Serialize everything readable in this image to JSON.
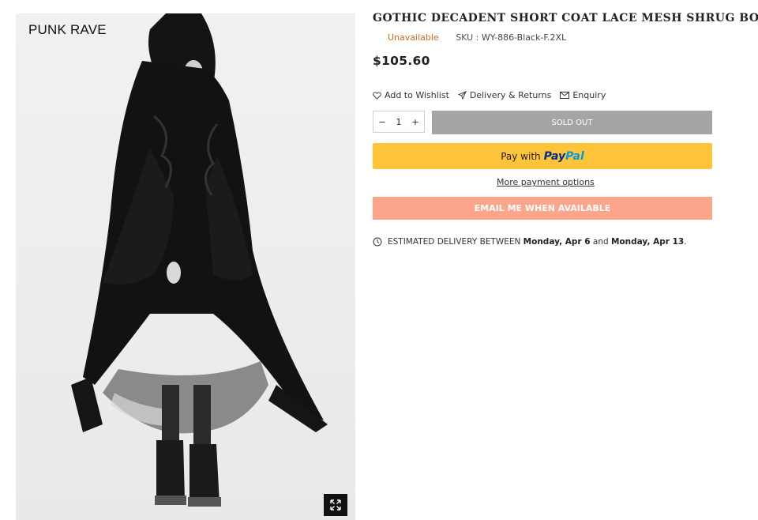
{
  "gallery": {
    "brand": "PUNK RAVE",
    "zoom_icon": "expand-arrows-icon"
  },
  "product": {
    "title": "GOTHIC DECADENT SHORT COAT LACE MESH SHRUG BOLERO",
    "availability": "Unavailable",
    "sku_label": "SKU :",
    "sku_value": "WY-886-Black-F.2XL",
    "price": "$105.60"
  },
  "links": {
    "wishlist": "Add to Wishlist",
    "delivery": "Delivery & Returns",
    "enquiry": "Enquiry"
  },
  "purchase": {
    "qty_minus": "−",
    "qty_value": "1",
    "qty_plus": "+",
    "sold_out": "SOLD OUT",
    "paypal_prefix": "Pay with",
    "paypal_brand_1": "Pay",
    "paypal_brand_2": "Pal",
    "more_options": "More payment options",
    "email_button": "EMAIL ME WHEN AVAILABLE"
  },
  "delivery": {
    "prefix": "ESTIMATED DELIVERY BETWEEN",
    "start": "Monday, Apr 6",
    "middle": "and",
    "end": "Monday, Apr 13",
    "suffix": "."
  },
  "colors": {
    "availability": "#d4691e",
    "sold_out_bg": "#a5a5a5",
    "paypal_bg": "#ffc439",
    "email_bg": "#fda58a"
  }
}
